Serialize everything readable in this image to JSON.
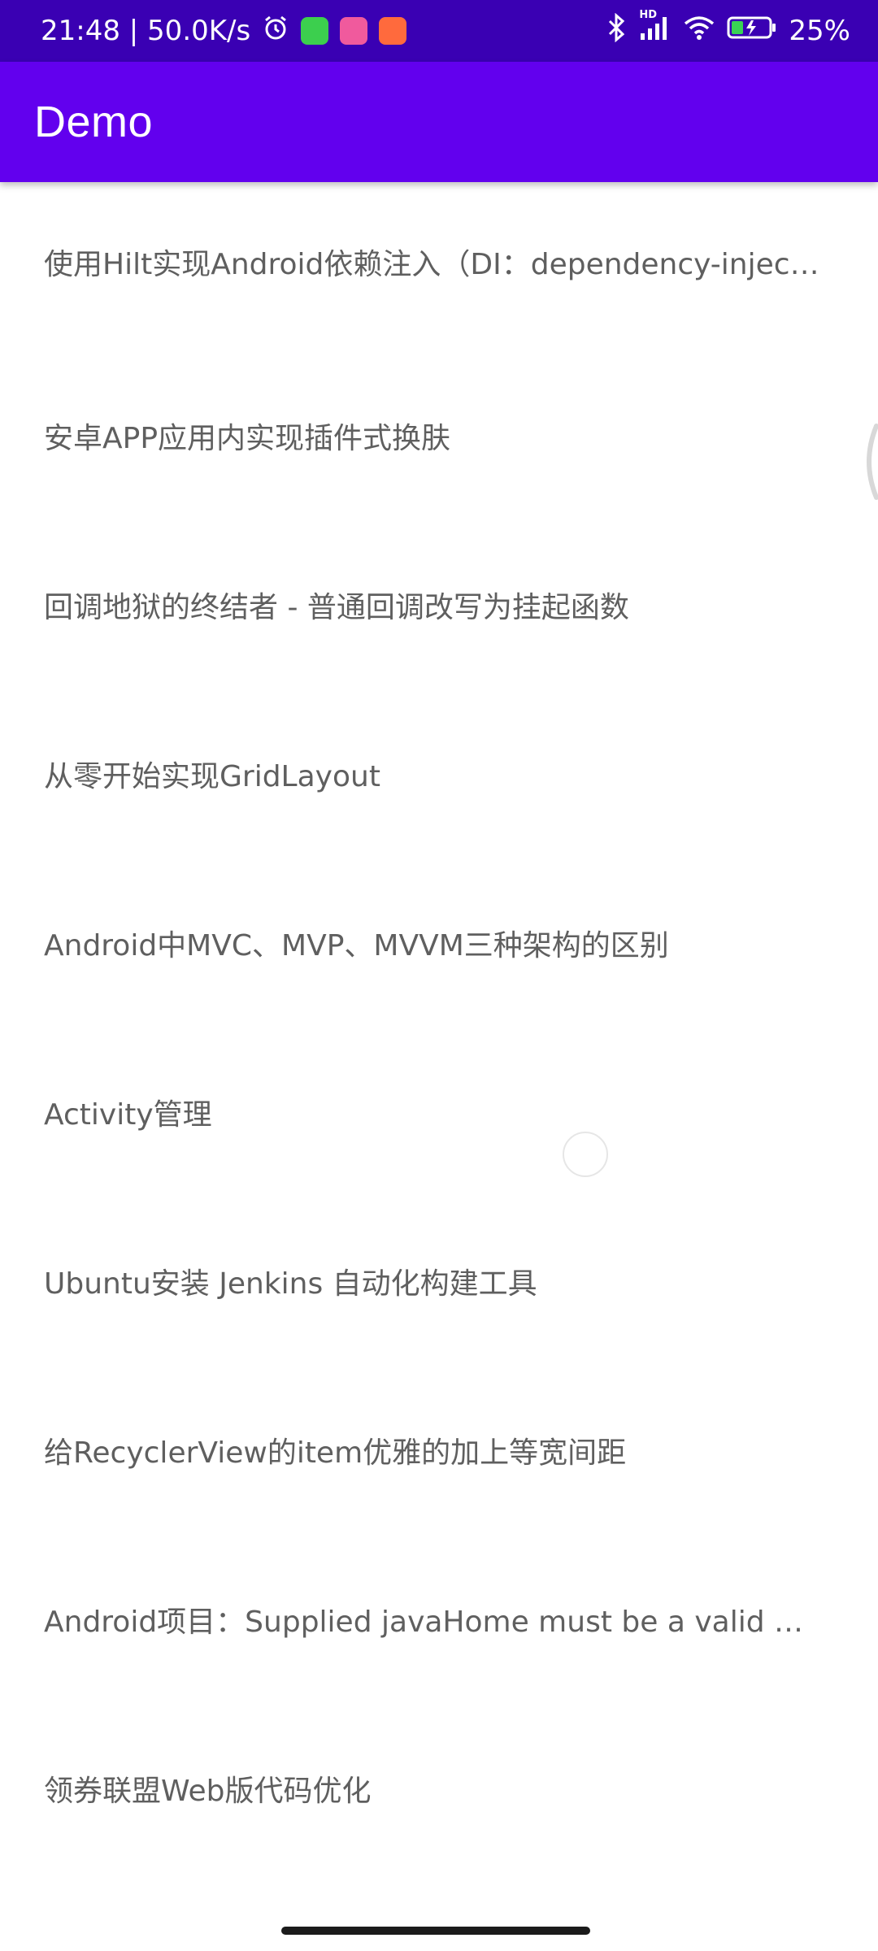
{
  "status_bar": {
    "time_speed": "21:48 | 50.0K/s",
    "battery": "25%",
    "hd_label": "HD",
    "colors": {
      "bg": "#3a00b3"
    }
  },
  "app_bar": {
    "title": "Demo",
    "colors": {
      "bg": "#6200ee",
      "text": "#ffffff"
    }
  },
  "list": {
    "items": [
      "使用Hilt实现Android依赖注入（DI：dependency-injecti...",
      "安卓APP应用内实现插件式换肤",
      "回调地狱的终结者 - 普通回调改写为挂起函数",
      "从零开始实现GridLayout",
      "Android中MVC、MVP、MVVM三种架构的区别",
      "Activity管理",
      "Ubuntu安装 Jenkins 自动化构建工具",
      "给RecyclerView的item优雅的加上等宽间距",
      "Android项目：Supplied javaHome must be a valid dire...",
      "领券联盟Web版代码优化"
    ],
    "text_color": "#5f5f5f"
  },
  "icons": {
    "alarm": "alarm-icon",
    "bluetooth": "bluetooth-icon",
    "signal": "signal-icon",
    "wifi": "wifi-icon",
    "battery": "battery-icon"
  }
}
